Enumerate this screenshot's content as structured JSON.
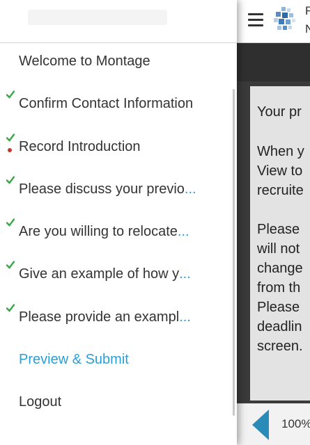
{
  "app": {
    "title_line1": "F",
    "title_line2": "N",
    "content": {
      "para1": "Your pr",
      "para2": "When y\nView to\nrecruite",
      "para3": "Please\nwill not\nchange\nfrom th\nPlease\ndeadlin\nscreen."
    },
    "footer": {
      "progress": "100%"
    }
  },
  "menu": {
    "items": [
      {
        "label": "Welcome to Montage",
        "ellipsis": "",
        "completed": false,
        "current": false,
        "link": false
      },
      {
        "label": "Confirm Contact Information",
        "ellipsis": "",
        "completed": true,
        "current": false,
        "link": false
      },
      {
        "label": "Record Introduction",
        "ellipsis": "",
        "completed": true,
        "current": true,
        "link": false
      },
      {
        "label": "Please discuss your previo",
        "ellipsis": "...",
        "completed": true,
        "current": false,
        "link": false
      },
      {
        "label": "Are you willing to relocate",
        "ellipsis": "...",
        "completed": true,
        "current": false,
        "link": false
      },
      {
        "label": "Give an example of how y",
        "ellipsis": "...",
        "completed": true,
        "current": false,
        "link": false
      },
      {
        "label": "Please provide an exampl",
        "ellipsis": "...",
        "completed": true,
        "current": false,
        "link": false
      },
      {
        "label": "Preview & Submit",
        "ellipsis": "",
        "completed": false,
        "current": false,
        "link": true
      },
      {
        "label": "Logout",
        "ellipsis": "",
        "completed": false,
        "current": false,
        "link": false
      }
    ]
  },
  "colors": {
    "check": "#3aa64a",
    "link": "#2a9fd6",
    "current_dot": "#c0392b",
    "arrow": "#2a8ab8"
  }
}
